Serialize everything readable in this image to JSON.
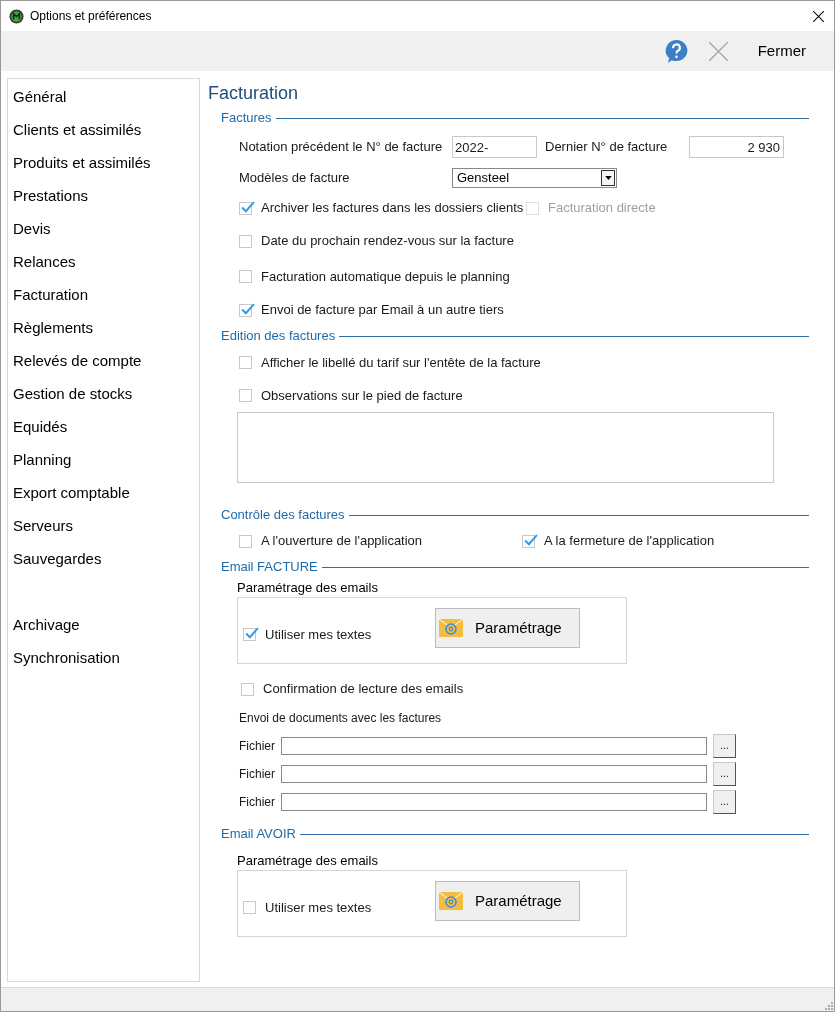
{
  "window": {
    "title": "Options et préférences"
  },
  "toolbar": {
    "close_label": "Fermer"
  },
  "sidebar": {
    "groups": [
      {
        "items": [
          "Général",
          "Clients et assimilés",
          "Produits et assimilés",
          "Prestations",
          "Devis",
          "Relances",
          "Facturation",
          "Règlements",
          "Relevés de compte",
          "Gestion de stocks",
          "Equidés",
          "Planning",
          "Export comptable",
          "Serveurs",
          "Sauvegardes"
        ]
      },
      {
        "items": [
          "Archivage",
          "Synchronisation"
        ]
      }
    ]
  },
  "page_title": "Facturation",
  "factures": {
    "title": "Factures",
    "prefix_label": "Notation précédent le N° de facture",
    "prefix_value": "2022-",
    "last_label": "Dernier N° de facture",
    "last_value": "2 930",
    "model_label": "Modèles de facture",
    "model_value": "Gensteel",
    "options": [
      {
        "items": [
          {
            "label": "Archiver les factures dans les dossiers clients",
            "checked": true,
            "disabled": false
          },
          {
            "label": "Facturation directe",
            "checked": false,
            "disabled": true
          }
        ]
      },
      {
        "items": [
          {
            "label": "Date du prochain rendez-vous sur la facture",
            "checked": false,
            "disabled": false
          }
        ]
      },
      {
        "items": [
          {
            "label": "Facturation automatique depuis le planning",
            "checked": false,
            "disabled": false
          }
        ]
      },
      {
        "items": [
          {
            "label": "Envoi de facture par Email à un autre tiers",
            "checked": true,
            "disabled": false
          }
        ]
      }
    ]
  },
  "edition": {
    "title": "Edition des factures",
    "options": [
      {
        "items": [
          {
            "label": "Afficher le libellé du tarif sur l'entête de la facture",
            "checked": false,
            "disabled": false
          }
        ]
      },
      {
        "items": [
          {
            "label": "Observations sur le pied de facture",
            "checked": false,
            "disabled": false
          }
        ]
      }
    ]
  },
  "controle": {
    "title": "Contrôle des factures",
    "options": [
      {
        "items": [
          {
            "label": "A l'ouverture de l'application",
            "checked": false,
            "disabled": false
          },
          {
            "label": "A la fermeture de l'application",
            "checked": true,
            "disabled": false
          }
        ]
      }
    ]
  },
  "email_facture": {
    "title": "Email FACTURE",
    "settings_label": "Paramétrage des emails",
    "use_texts": {
      "label": "Utiliser mes textes",
      "checked": true
    },
    "button_label": "Paramétrage",
    "read_confirm": {
      "label": "Confirmation de lecture des emails",
      "checked": false
    },
    "docs_label": "Envoi de documents avec les factures",
    "files": [
      {
        "label": "Fichier",
        "browse": "..."
      },
      {
        "label": "Fichier",
        "browse": "..."
      },
      {
        "label": "Fichier",
        "browse": "..."
      }
    ]
  },
  "email_avoir": {
    "title": "Email AVOIR",
    "settings_label": "Paramétrage des emails",
    "use_texts": {
      "label": "Utiliser mes textes",
      "checked": false
    },
    "button_label": "Paramétrage"
  }
}
